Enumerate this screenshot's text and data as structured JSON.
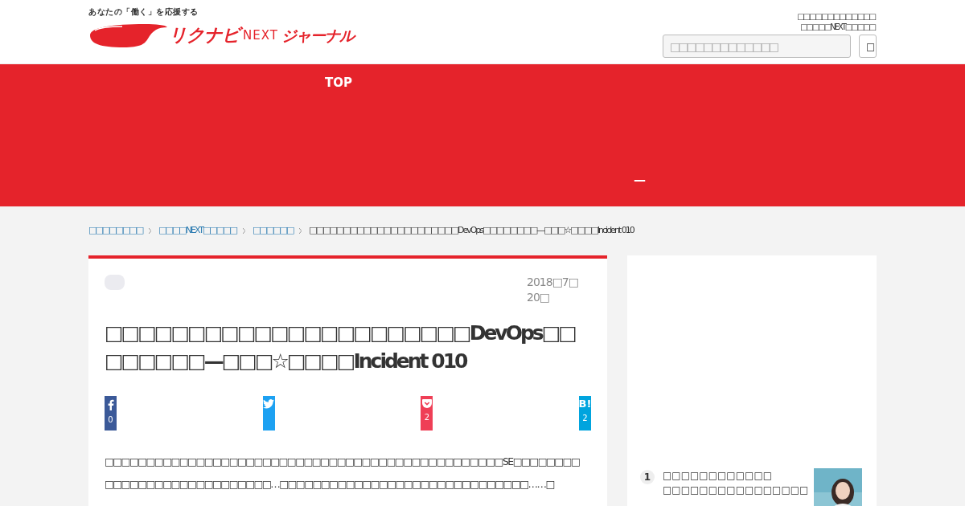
{
  "header": {
    "tagline": "あなたの「働く」を応援する",
    "logo": [
      "リクナビ",
      "NEXT",
      "ジャーナル"
    ],
    "notice_lines": [
      "□□□□□□□□□□□□□",
      "□□□□□NEXT□□□□□"
    ],
    "search": {
      "placeholder": "□□□□□□□□□□□□□"
    },
    "search_button": "□"
  },
  "nav": {
    "items": [
      "TOP",
      "—"
    ]
  },
  "breadcrumbs": [
    {
      "label": "□□□□□□□□",
      "link": true
    },
    {
      "label": "□□□□NEXT□□□□□",
      "link": true
    },
    {
      "label": "□□□□□□",
      "link": true
    },
    {
      "label": "□□□□□□□□□□□□□□□□□□□□□□DevOps□□□□□□□□—□□□☆□□□□Incident 010",
      "link": false
    }
  ],
  "article": {
    "date": "2018□7□20□",
    "title": "□□□□□□□□□□□□□□□□□□□□□□DevOps□□□□□□□□—□□□☆□□□□Incident 010",
    "share": [
      {
        "kind": "facebook",
        "count": "0"
      },
      {
        "kind": "twitter"
      },
      {
        "kind": "pocket",
        "count": "2"
      },
      {
        "kind": "hatena",
        "glyph": "B!",
        "count": "2"
      }
    ],
    "lead": "□□□□□□□□□□□□□□□□□□□□□□□□□□□□□□□□□□□□□□□□□□□□□□□□SE□□□□□□□□□□□□□□□□□□□□□□□□□□□□…□□□□□□□□□□□□□□□□□□□□□□□□□□□□□□……□"
  },
  "ranking": [
    {
      "rank": "1",
      "title": "□□□□□□□□□□□□ □□□□□□□□□□□□□□□□",
      "kind": "picture"
    }
  ]
}
